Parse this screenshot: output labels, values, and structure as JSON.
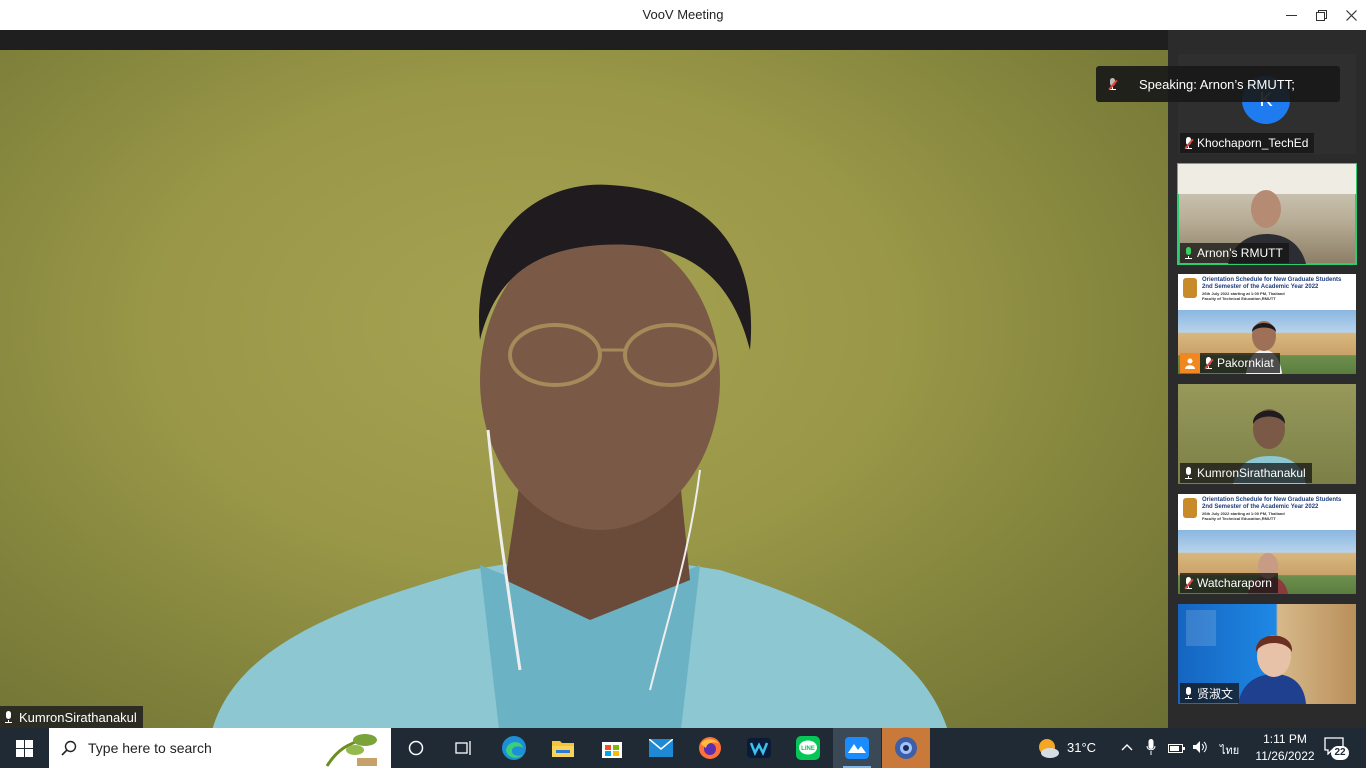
{
  "window": {
    "title": "VooV Meeting"
  },
  "main_video": {
    "participant_name": "KumronSirathanakul"
  },
  "speaking_banner": {
    "text": "Speaking: Arnon’s RMUTT;"
  },
  "participants": [
    {
      "name": "Khochaporn_TechEd",
      "mic": "muted",
      "avatar_letter": "K"
    },
    {
      "name": "Arnon’s RMUTT",
      "mic": "active"
    },
    {
      "name": "Pakornkiat",
      "mic": "muted"
    },
    {
      "name": "KumronSirathanakul",
      "mic": "on"
    },
    {
      "name": "Watcharaporn",
      "mic": "muted"
    },
    {
      "name": "贤淑文",
      "mic": "on"
    }
  ],
  "poster": {
    "line1": "Orientation Schedule for New Graduate Students",
    "line2": "2nd Semester of the Academic Year 2022",
    "line3": "26th July 2022 starting at 1:00 PM, Thailand",
    "line4": "Faculty of Technical Education,RMUTT"
  },
  "taskbar": {
    "search_placeholder": "Type here to search",
    "weather_temp": "31°C",
    "language": "ไทย",
    "time": "1:11 PM",
    "date": "11/26/2022",
    "notification_count": "22"
  },
  "colors": {
    "accent": "#2ecc71",
    "taskbar": "#1f2a35",
    "muted_mic": "#e0443a"
  }
}
